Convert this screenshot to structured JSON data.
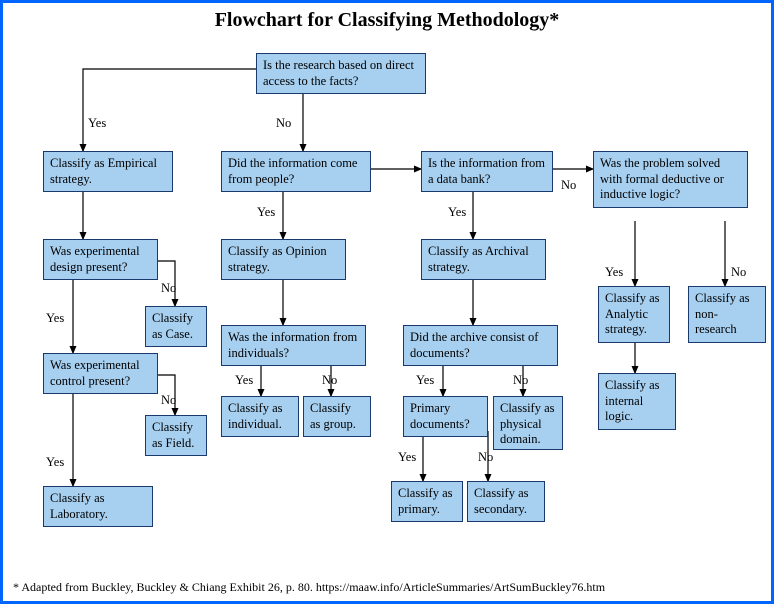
{
  "title": "Flowchart for Classifying Methodology*",
  "footer": "* Adapted from Buckley, Buckley & Chiang Exhibit 26, p. 80. https://maaw.info/ArticleSummaries/ArtSumBuckley76.htm",
  "labels": {
    "yes": "Yes",
    "no": "No"
  },
  "nodes": {
    "q_direct": "Is the research  based on direct  access to the facts?",
    "c_empirical": "Classify as  Empirical strategy.",
    "q_design": "Was experimental design present?",
    "c_case": "Classify as Case.",
    "q_control": "Was experimental control present?",
    "c_field": "Classify as Field.",
    "c_lab": "Classify as Laboratory.",
    "q_people": "Did the information come from people?",
    "c_opinion": "Classify as  Opinion strategy.",
    "q_individuals": "Was the information from individuals?",
    "c_individual": "Classify as individual.",
    "c_group": "Classify as group.",
    "q_databank": "Is the information from a data bank?",
    "c_archival": "Classify as  Archival strategy.",
    "q_documents": "Did the archive consist of documents?",
    "c_physical": "Classify as physical domain.",
    "q_primary": "Primary documents?",
    "c_primary": "Classify as primary.",
    "c_secondary": "Classify as secondary.",
    "q_logic": "Was the problem solved with formal deductive or inductive logic?",
    "c_analytic": "Classify as Analytic strategy.",
    "c_nonresearch": "Classify as non-research",
    "c_internal": "Classify as internal logic."
  }
}
